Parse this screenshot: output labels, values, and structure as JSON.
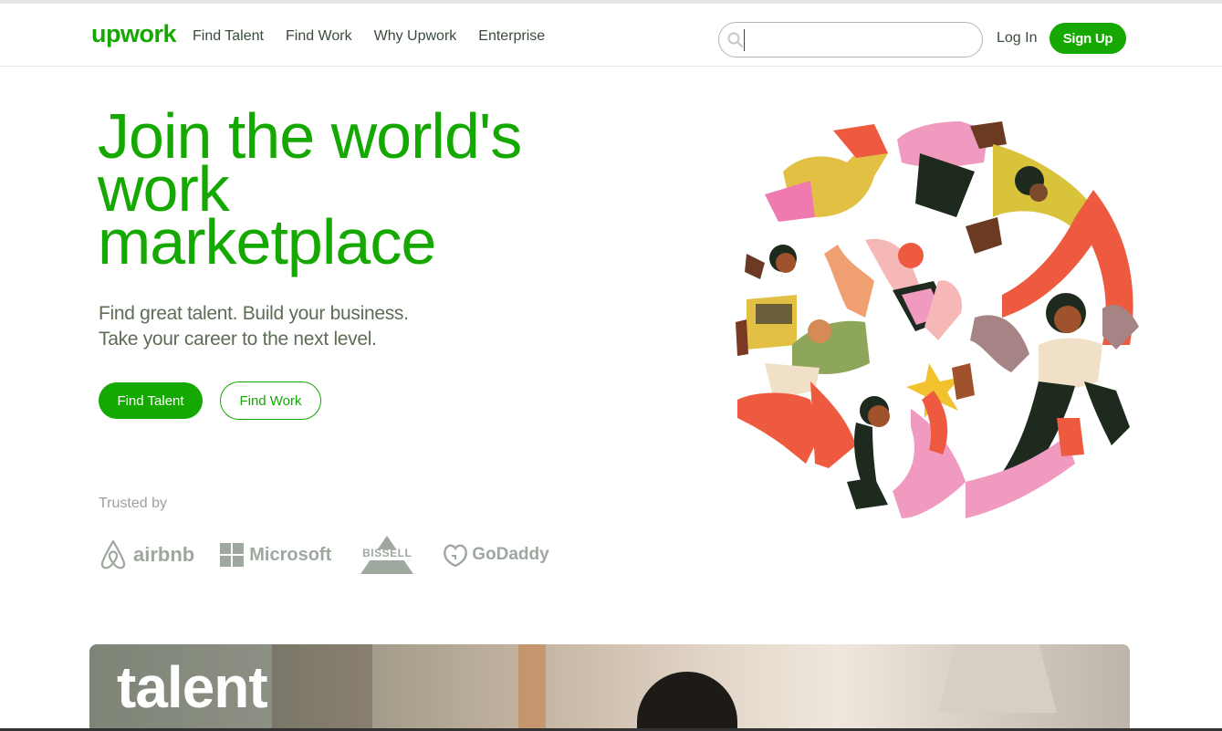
{
  "header": {
    "logo": "upwork",
    "nav": [
      "Find Talent",
      "Find Work",
      "Why Upwork",
      "Enterprise"
    ],
    "search": {
      "value": "",
      "placeholder": ""
    },
    "login": "Log In",
    "signup": "Sign Up"
  },
  "hero": {
    "title_lines": [
      "Join the world's",
      "work",
      "marketplace"
    ],
    "subtitle_lines": [
      "Find great talent. Build your business.",
      "Take your career to the next level."
    ],
    "primary_button": "Find Talent",
    "secondary_button": "Find Work"
  },
  "trusted": {
    "label": "Trusted by",
    "brands": [
      "airbnb",
      "Microsoft",
      "BISSELL",
      "GoDaddy"
    ]
  },
  "card": {
    "heading": "talent"
  },
  "colors": {
    "brand_green": "#14a800",
    "text_muted": "#5e6d55",
    "logo_gray": "#9fa89f"
  },
  "icons": [
    "search-icon",
    "people-collaboration-illustration"
  ]
}
